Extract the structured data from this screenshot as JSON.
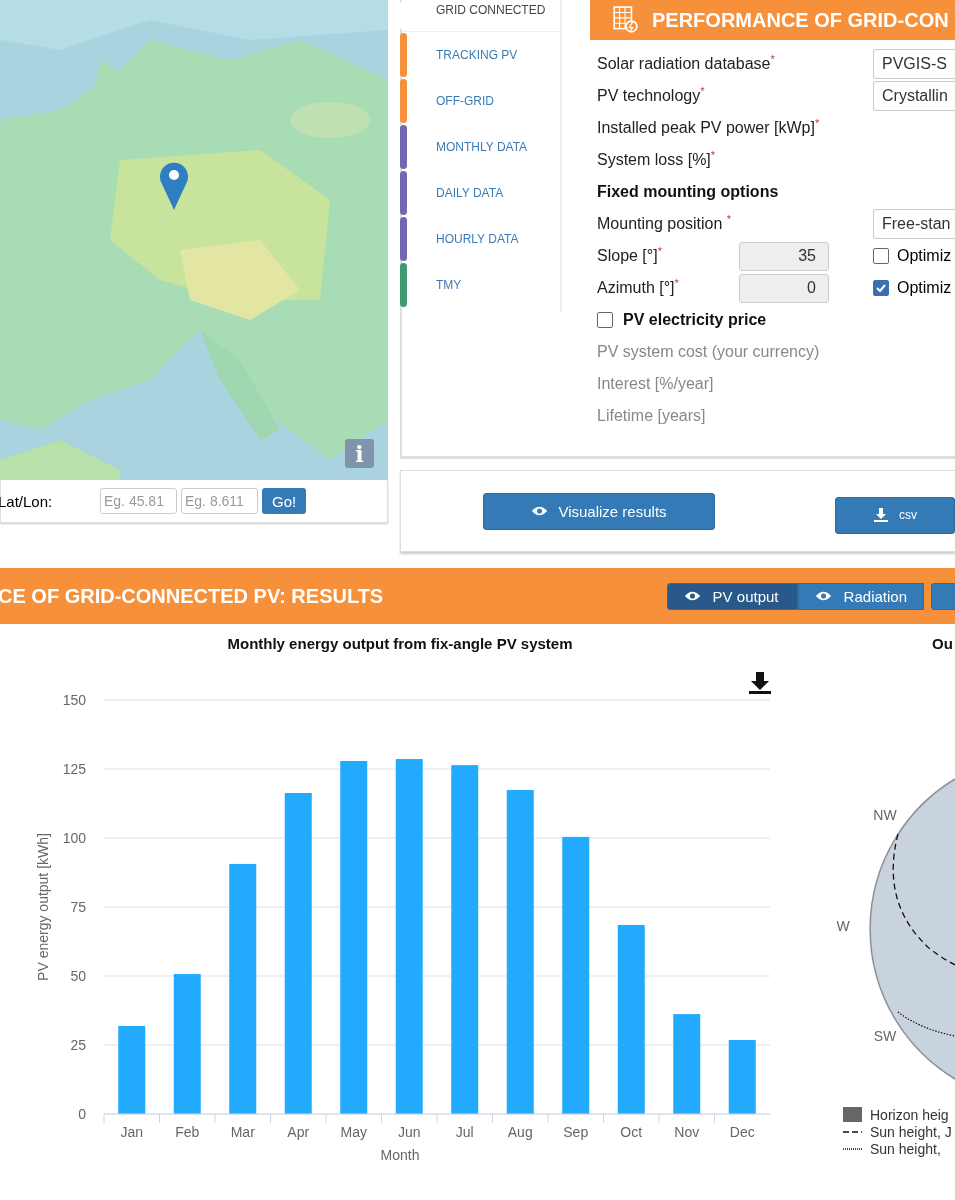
{
  "map": {
    "kind": "picture",
    "info_button": "i"
  },
  "location": {
    "label": "Lat/Lon:",
    "lat_placeholder": "Eg. 45.81",
    "lon_placeholder": "Eg. 8.611",
    "go_button": "Go!"
  },
  "tabs": [
    {
      "label": "GRID CONNECTED",
      "selected": true,
      "color": "#ffffff"
    },
    {
      "label": "TRACKING PV",
      "selected": false,
      "color": "#f7903a"
    },
    {
      "label": "OFF-GRID",
      "selected": false,
      "color": "#f7903a"
    },
    {
      "label": "MONTHLY DATA",
      "selected": false,
      "color": "#7466b0"
    },
    {
      "label": "DAILY DATA",
      "selected": false,
      "color": "#7466b0"
    },
    {
      "label": "HOURLY DATA",
      "selected": false,
      "color": "#7466b0"
    },
    {
      "label": "TMY",
      "selected": false,
      "color": "#3f9a72"
    }
  ],
  "form": {
    "title": "PERFORMANCE OF GRID-CON",
    "rows": [
      {
        "kind": "select",
        "label": "Solar radiation database$^{*}$",
        "value": "PVGIS-S"
      },
      {
        "kind": "select",
        "label": "PV technology$^{*}$",
        "value": "Crystallin"
      },
      {
        "kind": "label",
        "label": "Installed peak PV power [kWp]$^{*}$"
      },
      {
        "kind": "label",
        "label": "System loss [%]$^{*}$"
      },
      {
        "kind": "heading",
        "label": "Fixed mounting options"
      },
      {
        "kind": "select",
        "label": "Mounting position $^{*}$",
        "value": "Free-stan"
      },
      {
        "kind": "number",
        "label": "Slope [°]$^{*}$",
        "value": "35",
        "option": "Optimiz",
        "checked": false
      },
      {
        "kind": "number",
        "label": "Azimuth [°]$^{*}$",
        "value": "0",
        "option": "Optimiz",
        "checked": true
      },
      {
        "kind": "check",
        "label": "PV electricity price",
        "checked": false
      },
      {
        "kind": "disabled",
        "label": "PV system cost (your currency)"
      },
      {
        "kind": "disabled",
        "label": "Interest [%/year]"
      },
      {
        "kind": "disabled",
        "label": "Lifetime [years]"
      }
    ]
  },
  "actions": {
    "visualize": "Visualize results",
    "csv": "csv"
  },
  "results": {
    "title": "CE OF GRID-CONNECTED PV: RESULTS",
    "buttons": [
      {
        "label": "PV output",
        "selected": true
      },
      {
        "label": "Radiation",
        "selected": false
      }
    ],
    "chart_data": {
      "type": "bar",
      "title": "Monthly energy output from fix-angle PV system",
      "xlabel": "Month",
      "ylabel": "PV energy output [kWh]",
      "categories": [
        "Jan",
        "Feb",
        "Mar",
        "Apr",
        "May",
        "Jun",
        "Jul",
        "Aug",
        "Sep",
        "Oct",
        "Nov",
        "Dec"
      ],
      "grid": true,
      "series": [
        {
          "color": "#22aaff",
          "values": [
            31.9,
            50.7,
            90.6,
            116.3,
            127.9,
            128.6,
            126.4,
            117.4,
            100.4,
            68.5,
            36.2,
            26.8
          ]
        }
      ],
      "ylim": [
        0,
        150
      ],
      "yticks": [
        0,
        25,
        50,
        75,
        100,
        125,
        150
      ]
    }
  },
  "horizon": {
    "title": "Ou",
    "directions": [
      "NW",
      "W",
      "SW"
    ],
    "legend": [
      {
        "kind": "swatch",
        "label": "Horizon heig"
      },
      {
        "kind": "dashed",
        "label": "Sun height, J"
      },
      {
        "kind": "dotted",
        "label": "Sun height,"
      }
    ]
  }
}
